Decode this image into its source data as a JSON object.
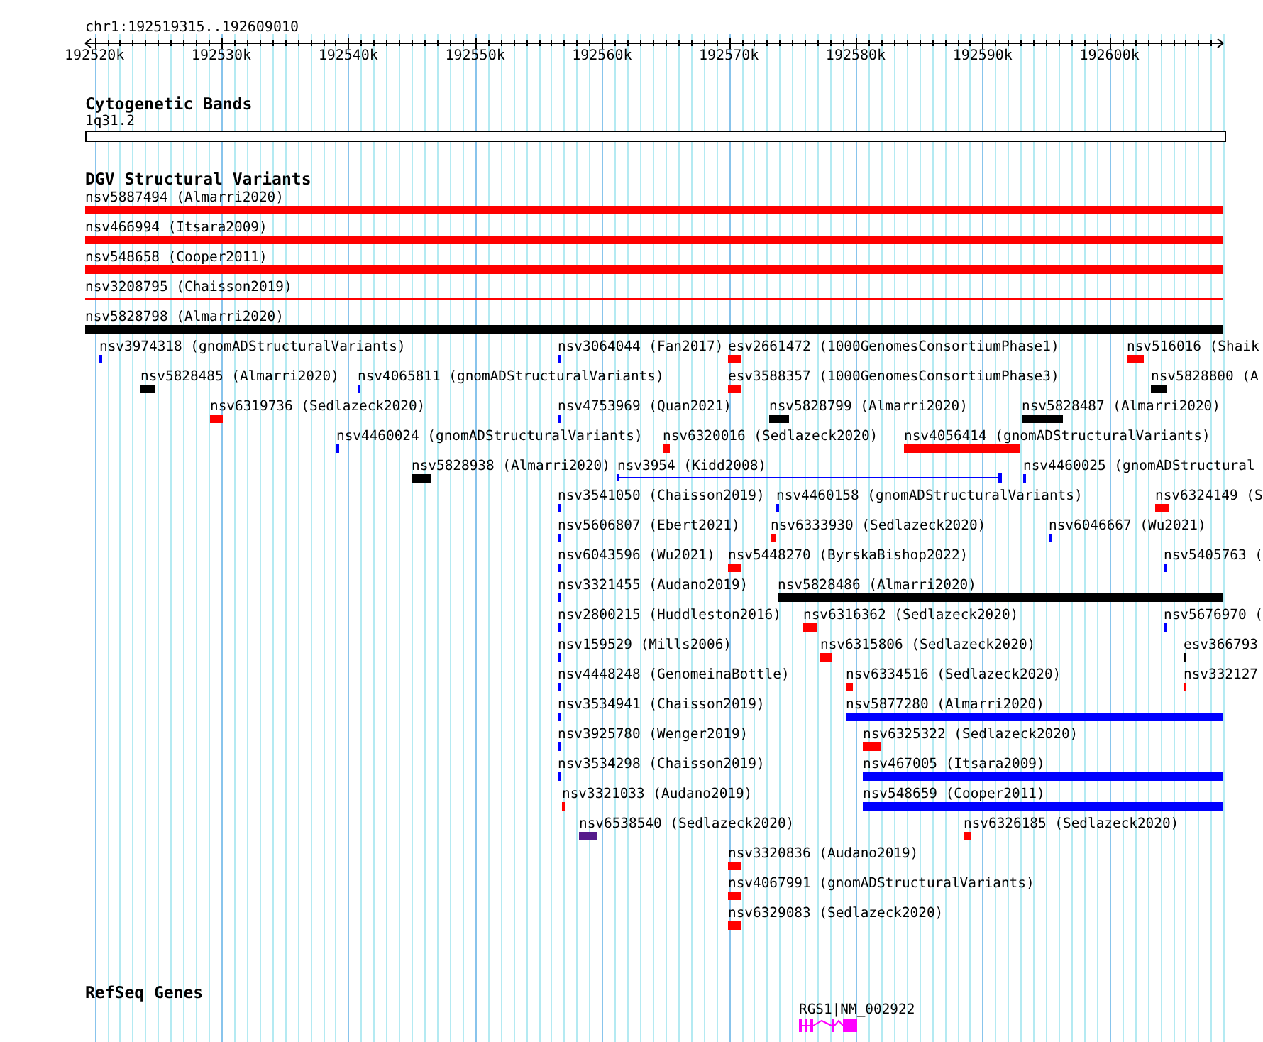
{
  "ruler": {
    "location": "chr1:192519315..192609010",
    "ticks": [
      {
        "label": "192520k"
      },
      {
        "label": "192530k"
      },
      {
        "label": "192540k"
      },
      {
        "label": "192550k"
      },
      {
        "label": "192560k"
      },
      {
        "label": "192570k"
      },
      {
        "label": "192580k"
      },
      {
        "label": "192590k"
      },
      {
        "label": "192600k"
      }
    ]
  },
  "tracks": [
    {
      "kind": "cytoband",
      "title": "Cytogenetic Bands",
      "bands": [
        {
          "label": "1q31.2"
        }
      ]
    },
    {
      "kind": "variants",
      "title": "DGV Structural Variants",
      "lanes": [
        [
          {
            "label": "nsv5887494 (Almarri2020)",
            "kind": "bar",
            "color": "#ff0000"
          }
        ],
        [
          {
            "label": "nsv466994 (Itsara2009)",
            "kind": "bar",
            "color": "#ff0000"
          }
        ],
        [
          {
            "label": "nsv548658 (Cooper2011)",
            "kind": "bar",
            "color": "#ff0000"
          }
        ],
        [
          {
            "label": "nsv3208795 (Chaisson2019)",
            "kind": "line",
            "color": "#ff0000"
          }
        ],
        [
          {
            "label": "nsv5828798 (Almarri2020)",
            "kind": "bar",
            "color": "#000000"
          }
        ],
        [
          {
            "label": "nsv3974318 (gnomADStructuralVariants)",
            "kind": "bar",
            "color": "#0000ff"
          },
          {
            "label": "nsv3064044 (Fan2017)",
            "kind": "bar",
            "color": "#0000ff"
          },
          {
            "label": "esv2661472 (1000GenomesConsortiumPhase1)",
            "kind": "bar",
            "color": "#ff0000"
          },
          {
            "label": "nsv516016 (Shaik",
            "kind": "bar",
            "color": "#ff0000"
          }
        ],
        [
          {
            "label": "nsv5828485 (Almarri2020)",
            "kind": "bar",
            "color": "#000000"
          },
          {
            "label": "nsv4065811 (gnomADStructuralVariants)",
            "kind": "bar",
            "color": "#0000ff"
          },
          {
            "label": "esv3588357 (1000GenomesConsortiumPhase3)",
            "kind": "bar",
            "color": "#ff0000"
          },
          {
            "label": "nsv5828800 (A",
            "kind": "bar",
            "color": "#000000"
          }
        ],
        [
          {
            "label": "nsv6319736 (Sedlazeck2020)",
            "kind": "bar",
            "color": "#ff0000"
          },
          {
            "label": "nsv4753969 (Quan2021)",
            "kind": "bar",
            "color": "#0000ff"
          },
          {
            "label": "nsv5828799 (Almarri2020)",
            "kind": "bar",
            "color": "#000000"
          },
          {
            "label": "nsv5828487 (Almarri2020)",
            "kind": "bar",
            "color": "#000000"
          }
        ],
        [
          {
            "label": "nsv4460024 (gnomADStructuralVariants)",
            "kind": "bar",
            "color": "#0000ff"
          },
          {
            "label": "nsv6320016 (Sedlazeck2020)",
            "kind": "bar",
            "color": "#ff0000"
          },
          {
            "label": "nsv4056414 (gnomADStructuralVariants)",
            "kind": "bar",
            "color": "#ff0000"
          }
        ],
        [
          {
            "label": "nsv5828938 (Almarri2020)",
            "kind": "bar",
            "color": "#000000"
          },
          {
            "label": "nsv3954 (Kidd2008)",
            "kind": "span",
            "color": "#0000ff"
          },
          {
            "label": "nsv4460025 (gnomADStructural",
            "kind": "bar",
            "color": "#0000ff"
          }
        ],
        [
          {
            "label": "nsv3541050 (Chaisson2019)",
            "kind": "bar",
            "color": "#0000ff"
          },
          {
            "label": "nsv4460158 (gnomADStructuralVariants)",
            "kind": "bar",
            "color": "#0000ff"
          },
          {
            "label": "nsv6324149 (S",
            "kind": "bar",
            "color": "#ff0000"
          }
        ],
        [
          {
            "label": "nsv5606807 (Ebert2021)",
            "kind": "bar",
            "color": "#0000ff"
          },
          {
            "label": "nsv6333930 (Sedlazeck2020)",
            "kind": "bar",
            "color": "#ff0000"
          },
          {
            "label": "nsv6046667 (Wu2021)",
            "kind": "bar",
            "color": "#0000ff"
          }
        ],
        [
          {
            "label": "nsv6043596 (Wu2021)",
            "kind": "bar",
            "color": "#0000ff"
          },
          {
            "label": "nsv5448270 (ByrskaBishop2022)",
            "kind": "bar",
            "color": "#ff0000"
          },
          {
            "label": "nsv5405763 (",
            "kind": "bar",
            "color": "#0000ff"
          }
        ],
        [
          {
            "label": "nsv3321455 (Audano2019)",
            "kind": "bar",
            "color": "#0000ff"
          },
          {
            "label": "nsv5828486 (Almarri2020)",
            "kind": "bar",
            "color": "#000000"
          }
        ],
        [
          {
            "label": "nsv2800215 (Huddleston2016)",
            "kind": "bar",
            "color": "#0000ff"
          },
          {
            "label": "nsv6316362 (Sedlazeck2020)",
            "kind": "bar",
            "color": "#ff0000"
          },
          {
            "label": "nsv5676970 (",
            "kind": "bar",
            "color": "#0000ff"
          }
        ],
        [
          {
            "label": "nsv159529 (Mills2006)",
            "kind": "bar",
            "color": "#0000ff"
          },
          {
            "label": "nsv6315806 (Sedlazeck2020)",
            "kind": "bar",
            "color": "#ff0000"
          },
          {
            "label": "esv366793",
            "kind": "bar",
            "color": "#000000"
          }
        ],
        [
          {
            "label": "nsv4448248 (GenomeinaBottle)",
            "kind": "bar",
            "color": "#0000ff"
          },
          {
            "label": "nsv6334516 (Sedlazeck2020)",
            "kind": "bar",
            "color": "#ff0000"
          },
          {
            "label": "nsv332127",
            "kind": "bar",
            "color": "#ff0000"
          }
        ],
        [
          {
            "label": "nsv3534941 (Chaisson2019)",
            "kind": "bar",
            "color": "#0000ff"
          },
          {
            "label": "nsv5877280 (Almarri2020)",
            "kind": "bar",
            "color": "#0000ff"
          }
        ],
        [
          {
            "label": "nsv3925780 (Wenger2019)",
            "kind": "bar",
            "color": "#0000ff"
          },
          {
            "label": "nsv6325322 (Sedlazeck2020)",
            "kind": "bar",
            "color": "#ff0000"
          }
        ],
        [
          {
            "label": "nsv3534298 (Chaisson2019)",
            "kind": "bar",
            "color": "#0000ff"
          },
          {
            "label": "nsv467005 (Itsara2009)",
            "kind": "bar",
            "color": "#0000ff"
          }
        ],
        [
          {
            "label": "nsv3321033 (Audano2019)",
            "kind": "bar",
            "color": "#ff0000"
          },
          {
            "label": "nsv548659 (Cooper2011)",
            "kind": "bar",
            "color": "#0000ff"
          }
        ],
        [
          {
            "label": "nsv6538540 (Sedlazeck2020)",
            "kind": "bar",
            "color": "#551a8b"
          },
          {
            "label": "nsv6326185 (Sedlazeck2020)",
            "kind": "bar",
            "color": "#ff0000"
          }
        ],
        [
          {
            "label": "nsv3320836 (Audano2019)",
            "kind": "bar",
            "color": "#ff0000"
          }
        ],
        [
          {
            "label": "nsv4067991 (gnomADStructuralVariants)",
            "kind": "bar",
            "color": "#ff0000"
          }
        ],
        [
          {
            "label": "nsv6329083 (Sedlazeck2020)",
            "kind": "bar",
            "color": "#ff0000"
          }
        ]
      ]
    },
    {
      "kind": "genes",
      "title": "RefSeq Genes",
      "genes": [
        {
          "label": "RGS1|NM_002922",
          "color": "#ff00ff"
        }
      ]
    }
  ]
}
